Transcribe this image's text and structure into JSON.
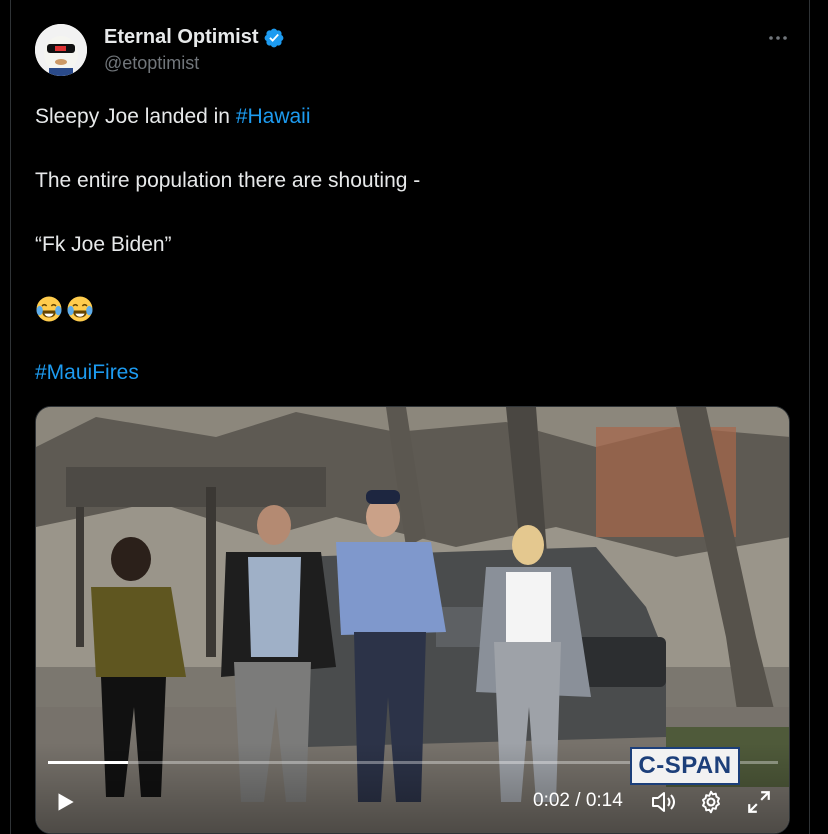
{
  "tweet": {
    "author": {
      "display_name": "Eternal Optimist",
      "handle": "@etoptimist",
      "verified": true,
      "verified_color": "#1d9bf0"
    },
    "more_icon": "more-horizontal-icon",
    "lines": {
      "line1_prefix": "Sleepy Joe landed in ",
      "line1_hashtag": "#Hawaii",
      "line2": "The entire population there are shouting -",
      "line3": "“Fk Joe Biden”",
      "line4_emojis": [
        "face-with-tears-of-joy",
        "face-with-tears-of-joy"
      ],
      "line5_hashtag": "#MauiFires"
    },
    "hashtag_color": "#1d9bf0"
  },
  "video": {
    "watermark": "C-SPAN",
    "time_display": "0:02 / 0:14",
    "progress_fraction": 0.11,
    "controls": {
      "play_icon": "play-icon",
      "volume_icon": "volume-icon",
      "settings_icon": "settings-gear-icon",
      "fullscreen_icon": "fullscreen-icon"
    }
  }
}
